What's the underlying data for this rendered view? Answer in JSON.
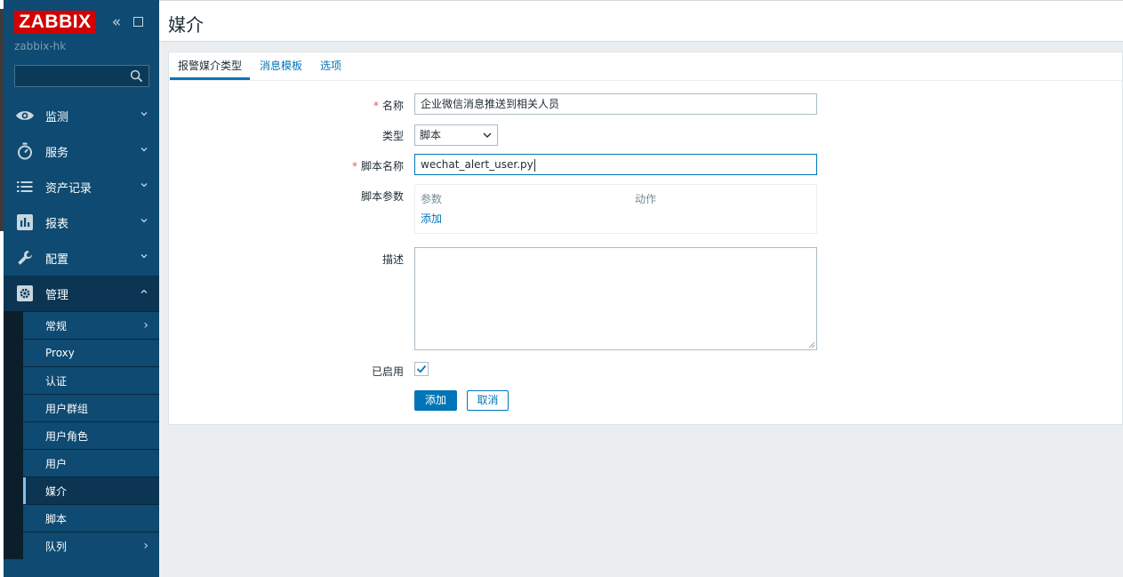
{
  "sidebar": {
    "logo": "ZABBIX",
    "server_name": "zabbix-hk",
    "search_placeholder": "",
    "menu": [
      {
        "label": "监测",
        "icon": "eye-icon"
      },
      {
        "label": "服务",
        "icon": "stopwatch-icon"
      },
      {
        "label": "资产记录",
        "icon": "list-icon"
      },
      {
        "label": "报表",
        "icon": "report-chart-icon"
      },
      {
        "label": "配置",
        "icon": "wrench-icon"
      },
      {
        "label": "管理",
        "icon": "gear-icon"
      }
    ],
    "admin_submenu": [
      {
        "label": "常规"
      },
      {
        "label": "Proxy"
      },
      {
        "label": "认证"
      },
      {
        "label": "用户群组"
      },
      {
        "label": "用户角色"
      },
      {
        "label": "用户"
      },
      {
        "label": "媒介"
      },
      {
        "label": "脚本"
      },
      {
        "label": "队列"
      }
    ]
  },
  "header": {
    "title": "媒介"
  },
  "tabs": [
    {
      "label": "报警媒介类型"
    },
    {
      "label": "消息模板"
    },
    {
      "label": "选项"
    }
  ],
  "form": {
    "name_label": "名称",
    "name_value": "企业微信消息推送到相关人员",
    "type_label": "类型",
    "type_value": "脚本",
    "script_name_label": "脚本名称",
    "script_name_value": "wechat_alert_user.py",
    "script_params_label": "脚本参数",
    "params_col_param": "参数",
    "params_col_action": "动作",
    "params_add_link": "添加",
    "description_label": "描述",
    "description_value": "",
    "enabled_label": "已启用",
    "enabled": true,
    "required_mark": "*"
  },
  "buttons": {
    "add": "添加",
    "cancel": "取消"
  },
  "colors": {
    "sidebar_bg": "#0e4a71",
    "accent": "#0275b8",
    "logo_red": "#d40000",
    "page_bg": "#ebeef0"
  }
}
